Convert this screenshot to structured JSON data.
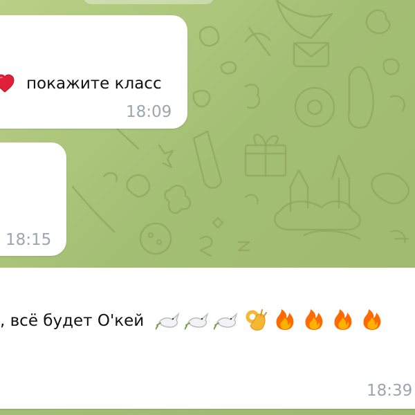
{
  "messages": [
    {
      "emoji": "heart-icon",
      "text": "покажите класс",
      "time": "18:09"
    },
    {
      "text": "",
      "time": "18:15"
    },
    {
      "text": ", всё будет О'кей",
      "emoji": [
        "dove-icon",
        "dove-icon",
        "dove-icon",
        "ok-hand-icon",
        "fire-icon",
        "fire-icon",
        "fire-icon",
        "fire-icon"
      ],
      "time": "18:39"
    }
  ],
  "colors": {
    "background": "#a9c07a",
    "bubble": "#ffffff",
    "time": "#9aa6b0",
    "heart": "#e0203a",
    "fire": "#ff6a00"
  }
}
